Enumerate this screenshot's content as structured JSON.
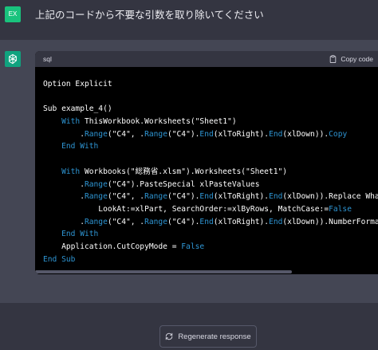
{
  "user": {
    "avatar_text": "EX",
    "message": "上記のコードから不要な引数を取り除いてください"
  },
  "assistant": {
    "avatar_icon": "openai-logo-icon",
    "code": {
      "language": "sql",
      "copy_label": "Copy code",
      "lines": [
        [
          {
            "t": "Option Explicit",
            "c": "plain"
          }
        ],
        [],
        [
          {
            "t": "Sub example_4()",
            "c": "plain"
          }
        ],
        [
          {
            "t": "    ",
            "c": "plain"
          },
          {
            "t": "With",
            "c": "kw"
          },
          {
            "t": " ThisWorkbook.Worksheets(\"Sheet1\")",
            "c": "plain"
          }
        ],
        [
          {
            "t": "        .",
            "c": "plain"
          },
          {
            "t": "Range",
            "c": "kw"
          },
          {
            "t": "(\"C4\", .",
            "c": "plain"
          },
          {
            "t": "Range",
            "c": "kw"
          },
          {
            "t": "(\"C4\").",
            "c": "plain"
          },
          {
            "t": "End",
            "c": "kw"
          },
          {
            "t": "(xlToRight).",
            "c": "plain"
          },
          {
            "t": "End",
            "c": "kw"
          },
          {
            "t": "(xlDown)).",
            "c": "plain"
          },
          {
            "t": "Copy",
            "c": "kw"
          }
        ],
        [
          {
            "t": "    ",
            "c": "plain"
          },
          {
            "t": "End With",
            "c": "kw"
          }
        ],
        [],
        [
          {
            "t": "    ",
            "c": "plain"
          },
          {
            "t": "With",
            "c": "kw"
          },
          {
            "t": " Workbooks(\"総務省.xlsm\").Worksheets(\"Sheet1\")",
            "c": "plain"
          }
        ],
        [
          {
            "t": "        .",
            "c": "plain"
          },
          {
            "t": "Range",
            "c": "kw"
          },
          {
            "t": "(\"C4\").PasteSpecial xlPasteValues",
            "c": "plain"
          }
        ],
        [
          {
            "t": "        .",
            "c": "plain"
          },
          {
            "t": "Range",
            "c": "kw"
          },
          {
            "t": "(\"C4\", .",
            "c": "plain"
          },
          {
            "t": "Range",
            "c": "kw"
          },
          {
            "t": "(\"C4\").",
            "c": "plain"
          },
          {
            "t": "End",
            "c": "kw"
          },
          {
            "t": "(xlToRight).",
            "c": "plain"
          },
          {
            "t": "End",
            "c": "kw"
          },
          {
            "t": "(xlDown)).Replace What:=",
            "c": "plain"
          }
        ],
        [
          {
            "t": "            LookAt:=xlPart, SearchOrder:=xlByRows, MatchCase:=",
            "c": "plain"
          },
          {
            "t": "False",
            "c": "kw"
          }
        ],
        [
          {
            "t": "        .",
            "c": "plain"
          },
          {
            "t": "Range",
            "c": "kw"
          },
          {
            "t": "(\"C4\", .",
            "c": "plain"
          },
          {
            "t": "Range",
            "c": "kw"
          },
          {
            "t": "(\"C4\").",
            "c": "plain"
          },
          {
            "t": "End",
            "c": "kw"
          },
          {
            "t": "(xlToRight).",
            "c": "plain"
          },
          {
            "t": "End",
            "c": "kw"
          },
          {
            "t": "(xlDown)).NumberFormatLo",
            "c": "plain"
          }
        ],
        [
          {
            "t": "    ",
            "c": "plain"
          },
          {
            "t": "End With",
            "c": "kw"
          }
        ],
        [
          {
            "t": "    Application.CutCopyMode = ",
            "c": "plain"
          },
          {
            "t": "False",
            "c": "kw"
          }
        ],
        [
          {
            "t": "End Sub",
            "c": "kw"
          }
        ]
      ]
    }
  },
  "footer": {
    "regenerate_label": "Regenerate response"
  },
  "colors": {
    "keyword": "#2e95d3",
    "user_avatar": "#19c37d",
    "assistant_avatar": "#10a37f"
  }
}
